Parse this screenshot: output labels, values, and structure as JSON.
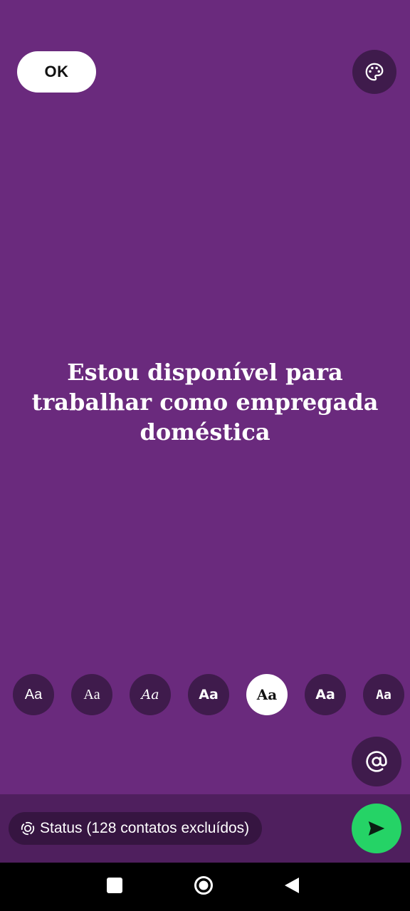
{
  "top_bar": {
    "ok_label": "OK",
    "palette_icon": "palette-icon"
  },
  "status": {
    "text": "Estou disponível para trabalhar como empregada doméstica",
    "background_color": "#6a2a7d",
    "text_color": "#ffffff"
  },
  "font_options": [
    {
      "label": "Aa",
      "selected": false
    },
    {
      "label": "Aa",
      "selected": false
    },
    {
      "label": "Aa",
      "selected": false
    },
    {
      "label": "Aa",
      "selected": false
    },
    {
      "label": "Aa",
      "selected": true
    },
    {
      "label": "Aa",
      "selected": false
    },
    {
      "label": "Aa",
      "selected": false
    }
  ],
  "mention": {
    "icon": "at-sign-icon",
    "label": "@"
  },
  "bottom_bar": {
    "audience_label": "Status (128 contatos excluídos)",
    "audience_icon": "status-ring-icon",
    "send_icon": "send-icon",
    "send_color": "#25d366"
  },
  "nav": {
    "recents_icon": "square-icon",
    "home_icon": "circle-icon",
    "back_icon": "triangle-back-icon"
  }
}
